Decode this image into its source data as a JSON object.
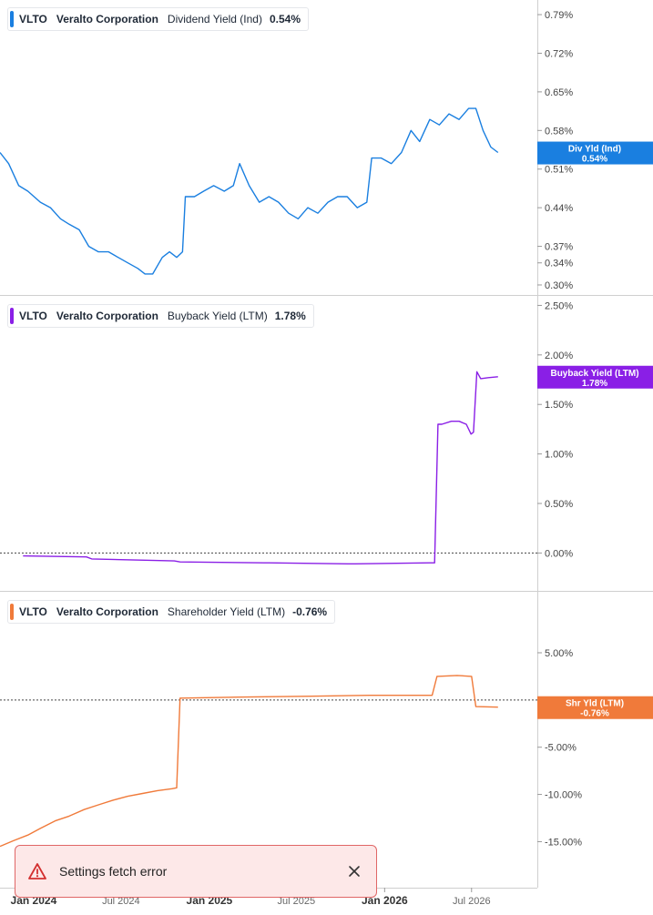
{
  "panels": [
    {
      "ticker": "VLTO",
      "company": "Veralto Corporation",
      "metric": "Dividend Yield (Ind)",
      "value": "0.54%",
      "color": "#1a7fe0"
    },
    {
      "ticker": "VLTO",
      "company": "Veralto Corporation",
      "metric": "Buyback Yield (LTM)",
      "value": "1.78%",
      "color": "#8a1fe6"
    },
    {
      "ticker": "VLTO",
      "company": "Veralto Corporation",
      "metric": "Shareholder Yield (LTM)",
      "value": "-0.76%",
      "color": "#f07a3a"
    }
  ],
  "toast": {
    "message": "Settings fetch error",
    "icon": "warning-triangle-icon",
    "close_icon": "close-icon"
  },
  "chart_data": [
    {
      "type": "line",
      "series": [
        {
          "name": "Dividend Yield (Ind)",
          "color": "#1a7fe0",
          "x": [
            "2023-10-23",
            "2023-11-10",
            "2023-12-01",
            "2023-12-20",
            "2024-01-15",
            "2024-02-05",
            "2024-02-26",
            "2024-03-15",
            "2024-04-05",
            "2024-04-25",
            "2024-05-15",
            "2024-06-05",
            "2024-06-25",
            "2024-07-15",
            "2024-08-05",
            "2024-08-20",
            "2024-09-05",
            "2024-09-25",
            "2024-10-10",
            "2024-10-25",
            "2024-11-06",
            "2024-11-12",
            "2024-12-01",
            "2024-12-20",
            "2025-01-10",
            "2025-02-01",
            "2025-02-20",
            "2025-03-05",
            "2025-03-25",
            "2025-04-15",
            "2025-05-05",
            "2025-05-25",
            "2025-06-15",
            "2025-07-05",
            "2025-07-25",
            "2025-08-15",
            "2025-09-05",
            "2025-09-25",
            "2025-10-15",
            "2025-11-05",
            "2025-11-25",
            "2025-12-05",
            "2025-12-25",
            "2026-01-15",
            "2026-02-05",
            "2026-02-25",
            "2026-03-15",
            "2026-04-05",
            "2026-04-25",
            "2026-05-15",
            "2026-06-05",
            "2026-06-25",
            "2026-07-10",
            "2026-07-25",
            "2026-08-10",
            "2026-08-25"
          ],
          "values": [
            0.54,
            0.52,
            0.48,
            0.47,
            0.45,
            0.44,
            0.42,
            0.41,
            0.4,
            0.37,
            0.36,
            0.36,
            0.35,
            0.34,
            0.33,
            0.32,
            0.32,
            0.35,
            0.36,
            0.35,
            0.36,
            0.46,
            0.46,
            0.47,
            0.48,
            0.47,
            0.48,
            0.52,
            0.48,
            0.45,
            0.46,
            0.45,
            0.43,
            0.42,
            0.44,
            0.43,
            0.45,
            0.46,
            0.46,
            0.44,
            0.45,
            0.53,
            0.53,
            0.52,
            0.54,
            0.58,
            0.56,
            0.6,
            0.59,
            0.61,
            0.6,
            0.62,
            0.62,
            0.58,
            0.55,
            0.54
          ]
        }
      ],
      "ylim": [
        0.295,
        0.8
      ],
      "yticks": [
        "0.79%",
        "0.72%",
        "0.65%",
        "0.58%",
        "0.51%",
        "0.44%",
        "0.37%",
        "0.34%",
        "0.30%"
      ],
      "ytick_values": [
        0.79,
        0.72,
        0.65,
        0.58,
        0.51,
        0.44,
        0.37,
        0.34,
        0.3
      ],
      "last_label": {
        "title": "Div Yld (Ind)",
        "value": "0.54%"
      }
    },
    {
      "type": "line",
      "series": [
        {
          "name": "Buyback Yield (LTM)",
          "color": "#8a1fe6",
          "x": [
            "2023-12-10",
            "2024-04-20",
            "2024-05-01",
            "2024-10-20",
            "2024-11-01",
            "2025-04-25",
            "2025-05-05",
            "2025-10-20",
            "2025-11-01",
            "2026-04-05",
            "2026-04-15",
            "2026-04-22",
            "2026-04-30",
            "2026-05-20",
            "2026-06-05",
            "2026-06-20",
            "2026-06-30",
            "2026-07-05",
            "2026-07-12",
            "2026-07-20",
            "2026-08-05",
            "2026-08-25"
          ],
          "values": [
            -0.03,
            -0.04,
            -0.06,
            -0.08,
            -0.09,
            -0.1,
            -0.1,
            -0.11,
            -0.11,
            -0.1,
            -0.1,
            1.3,
            1.3,
            1.33,
            1.33,
            1.3,
            1.2,
            1.22,
            1.83,
            1.76,
            1.77,
            1.78
          ]
        }
      ],
      "ylim": [
        -0.3,
        2.55
      ],
      "yticks": [
        "2.50%",
        "2.00%",
        "1.50%",
        "1.00%",
        "0.50%",
        "0.00%"
      ],
      "ytick_values": [
        2.5,
        2,
        1.5,
        1,
        0.5,
        0
      ],
      "last_label": {
        "title": "Buyback Yield (LTM)",
        "value": "1.78%"
      }
    },
    {
      "type": "line",
      "series": [
        {
          "name": "Shareholder Yield (LTM)",
          "color": "#f07a3a",
          "x": [
            "2023-10-23",
            "2023-11-20",
            "2023-12-20",
            "2024-01-15",
            "2024-02-15",
            "2024-03-15",
            "2024-04-15",
            "2024-05-15",
            "2024-06-15",
            "2024-07-15",
            "2024-08-15",
            "2024-09-15",
            "2024-10-15",
            "2024-10-25",
            "2024-11-01",
            "2025-03-01",
            "2025-08-01",
            "2025-12-01",
            "2026-04-10",
            "2026-04-20",
            "2026-06-01",
            "2026-07-01",
            "2026-07-10",
            "2026-08-25"
          ],
          "values": [
            -15.5,
            -14.9,
            -14.3,
            -13.6,
            -12.8,
            -12.3,
            -11.6,
            -11.1,
            -10.6,
            -10.2,
            -9.9,
            -9.6,
            -9.4,
            -9.3,
            0.2,
            0.3,
            0.4,
            0.5,
            0.5,
            2.5,
            2.6,
            2.5,
            -0.7,
            -0.76
          ]
        }
      ],
      "ylim": [
        -16.5,
        7.6
      ],
      "yticks": [
        "5.00%",
        "0.00%",
        "-5.00%",
        "-10.00%",
        "-15.00%"
      ],
      "ytick_values": [
        5,
        0,
        -5,
        -10,
        -15
      ],
      "last_label": {
        "title": "Shr Yld (LTM)",
        "value": "-0.76%"
      }
    }
  ],
  "xaxis": {
    "range": [
      "2023-10-23",
      "2026-11-15"
    ],
    "ticks": [
      {
        "date": "2024-01-01",
        "label": "Jan 2024",
        "major": true
      },
      {
        "date": "2024-07-01",
        "label": "Jul 2024",
        "major": false
      },
      {
        "date": "2025-01-01",
        "label": "Jan 2025",
        "major": true
      },
      {
        "date": "2025-07-01",
        "label": "Jul 2025",
        "major": false
      },
      {
        "date": "2026-01-01",
        "label": "Jan 2026",
        "major": true
      },
      {
        "date": "2026-07-01",
        "label": "Jul 2026",
        "major": false
      }
    ]
  }
}
